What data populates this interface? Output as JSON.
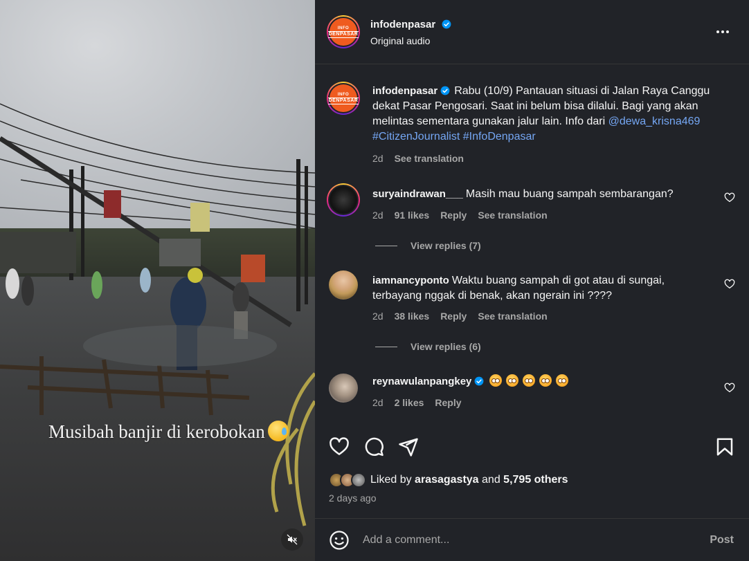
{
  "media": {
    "caption": "Musibah banjir di kerobokan",
    "caption_emoji": "sad-but-relieved-face",
    "mute_icon": "speaker-muted-icon"
  },
  "header": {
    "username": "infodenpasar",
    "subtitle": "Original audio",
    "logo_line1": "INFO",
    "logo_line2": "DENPASAR"
  },
  "caption": {
    "username": "infodenpasar",
    "text": "Rabu (10/9) Pantauan situasi di Jalan Raya Canggu dekat Pasar Pengosari. Saat ini belum bisa dilalui. Bagi yang akan melintas sementara gunakan jalur lain. Info dari",
    "mention": "@dewa_krisna469",
    "hashtags": "#CitizenJournalist #InfoDenpasar",
    "time": "2d",
    "see_translation": "See translation"
  },
  "comments": [
    {
      "username": "suryaindrawan___",
      "text": "Masih mau buang sampah sembarangan?",
      "time": "2d",
      "likes": "91 likes",
      "reply": "Reply",
      "see_translation": "See translation",
      "view_replies": "View replies (7)"
    },
    {
      "username": "iamnancyponto",
      "text": "Waktu buang sampah di got atau di sungai, terbayang nggak di benak, akan ngerain ini ????",
      "time": "2d",
      "likes": "38 likes",
      "reply": "Reply",
      "see_translation": "See translation",
      "view_replies": "View replies (6)"
    },
    {
      "username": "reynawulanpangkey",
      "emoji_count": 5,
      "emoji_name": "flushed-face",
      "time": "2d",
      "likes": "2 likes",
      "reply": "Reply"
    }
  ],
  "likes": {
    "prefix": "Liked by",
    "user": "arasagastya",
    "joiner": "and",
    "others": "5,795 others"
  },
  "time_ago": "2 days ago",
  "add_comment": {
    "placeholder": "Add a comment...",
    "post_label": "Post"
  },
  "colors": {
    "panel_bg": "#212328",
    "text": "#f5f5f5",
    "muted": "#a8a8a8",
    "link": "#75a7f4",
    "verified": "#0095f6",
    "brand_orange": "#ef5b1f"
  }
}
